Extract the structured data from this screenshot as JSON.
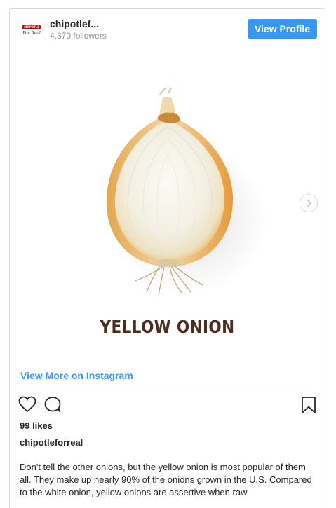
{
  "header": {
    "avatar_logo_top": "CHIPOTLE",
    "avatar_logo_script": "For Real",
    "username": "chipotlef...",
    "followers": "4,370 followers",
    "view_profile_label": "View Profile"
  },
  "media": {
    "product_name": "YELLOW ONION",
    "next_icon": "chevron-right-icon"
  },
  "links": {
    "view_more": "View More on Instagram"
  },
  "actions": {
    "like_icon": "heart-icon",
    "comment_icon": "comment-icon",
    "save_icon": "bookmark-icon"
  },
  "post": {
    "likes": "99 likes",
    "author": "chipotleforreal",
    "caption": "Don't tell the other onions, but the yellow onion is most popular of them all. They make up nearly 90% of the onions grown in the U.S. Compared to the white onion, yellow onions are assertive when raw"
  },
  "colors": {
    "accent": "#3897f0",
    "brand_red": "#a81612",
    "product_text": "#4a2d21"
  }
}
